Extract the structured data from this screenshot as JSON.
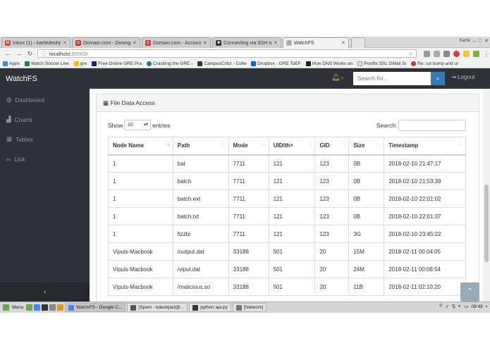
{
  "browser": {
    "tabs": [
      {
        "label": "Inbox (1) - kartikdeshpa",
        "icon_color": "#d44638",
        "icon": "M"
      },
      {
        "label": "Domain.com - Downgra",
        "icon_color": "#c0392b",
        "icon": "◎"
      },
      {
        "label": "Domain.com - Account",
        "icon_color": "#c0392b",
        "icon": "◎"
      },
      {
        "label": "Connecting via SSH to y",
        "icon_color": "#333333",
        "icon": "■"
      },
      {
        "label": "WatchFS",
        "icon_color": "#888888",
        "icon": "▯"
      }
    ],
    "window_user": "Kartik",
    "url_host": "localhost",
    "url_rest": ":5000/#",
    "bookmarks": [
      {
        "label": "Apps",
        "color": "#4285f4"
      },
      {
        "label": "Watch Soccer Live",
        "color": "#2e7d32"
      },
      {
        "label": "gre",
        "color": "#fbbc05"
      },
      {
        "label": "Free Online GRE Pra",
        "color": "#1a237e"
      },
      {
        "label": "Cracking the GRE -",
        "color": "#21759b"
      },
      {
        "label": "CampusCribz - Colle",
        "color": "#333333"
      },
      {
        "label": "Dropbox - GRE ToEF",
        "color": "#0061ff"
      },
      {
        "label": "How DNS Works an",
        "color": "#222222"
      },
      {
        "label": "Postfix SSL GMail Si",
        "color": "#555555"
      },
      {
        "label": "Re: ssl bump and ur",
        "color": "#c0392b"
      }
    ]
  },
  "navbar": {
    "brand": "WatchFS",
    "search_placeholder": "Search for...",
    "logout": "Logout"
  },
  "sidebar": {
    "items": [
      {
        "label": "Dashboard",
        "icon": "dashboard-icon"
      },
      {
        "label": "Charts",
        "icon": "chart-icon"
      },
      {
        "label": "Tables",
        "icon": "table-icon"
      },
      {
        "label": "Link",
        "icon": "link-icon"
      }
    ],
    "collapse": "‹"
  },
  "panel": {
    "title": "File Data Access",
    "show_label": "Show",
    "page_length": "10",
    "entries_label": "entries",
    "search_label": "Search:"
  },
  "table": {
    "columns": [
      "Node Name",
      "Path",
      "Mode",
      "UID/th>",
      "GID",
      "Size",
      "Timestamp"
    ],
    "rows": [
      [
        "1",
        "bat",
        "7711",
        "121",
        "123",
        "0B",
        "2018-02-10 21:47:17"
      ],
      [
        "1",
        "batch",
        "7711",
        "121",
        "123",
        "0B",
        "2018-02-10 21:53:39"
      ],
      [
        "1",
        "batch.ext",
        "7711",
        "121",
        "123",
        "0B",
        "2018-02-10 22:01:02"
      ],
      [
        "1",
        "batch.txt",
        "7711",
        "121",
        "123",
        "0B",
        "2018-02-10 22:01:37"
      ],
      [
        "1",
        "fizzbi",
        "7711",
        "121",
        "123",
        "3G",
        "2018-02-10 23:45:22"
      ],
      [
        "Vipuls-Macbook",
        "/output.dat",
        "33188",
        "501",
        "20",
        "15M",
        "2018-02-11 00:04:05"
      ],
      [
        "Vipuls-Macbook",
        "/vipul.dat",
        "33188",
        "501",
        "20",
        "24M",
        "2018-02-11 00:08:54"
      ],
      [
        "Vipuls-Macbook",
        "/malicious.so",
        "33188",
        "501",
        "20",
        "11B",
        "2018-02-11 02:10:20"
      ]
    ]
  },
  "taskbar": {
    "menu": "Menu",
    "tasks": [
      {
        "label": "WatchFS - Google C...",
        "active": true,
        "color": "#4285f4"
      },
      {
        "label": "[Spam - kdeshpa3@...",
        "active": false,
        "color": "#555555"
      },
      {
        "label": "python api.py",
        "active": false,
        "color": "#333333"
      },
      {
        "label": "[Network]",
        "active": false,
        "color": "#777777"
      }
    ],
    "clock": "08:49"
  },
  "colors": {
    "navbar_bg": "#2f3238",
    "accent": "#337ab7",
    "bell": "#e3b341"
  }
}
